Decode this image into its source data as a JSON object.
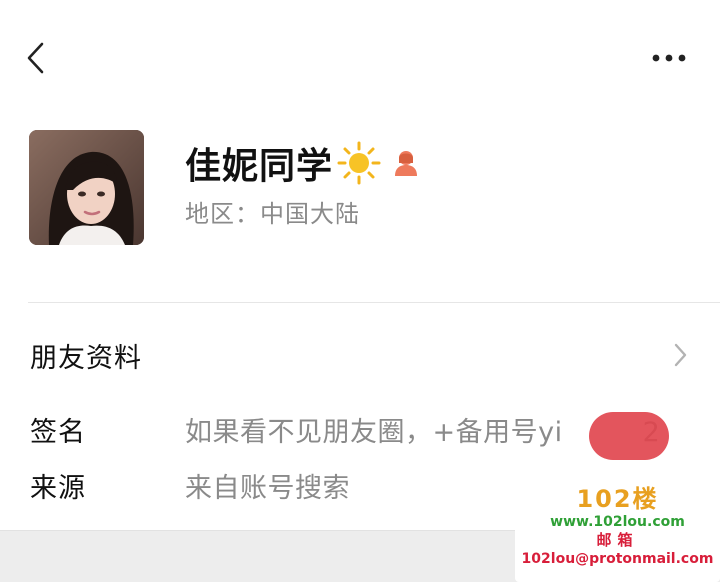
{
  "topbar": {
    "back_icon": "chevron-left-icon",
    "more_icon": "more-horizontal-icon"
  },
  "profile": {
    "avatar": "avatar",
    "name": "佳妮同学",
    "name_emoji_icon": "sun-icon",
    "gender_icon": "female-person-icon",
    "region": "地区：中国大陆"
  },
  "friend_info": {
    "label": "朋友资料",
    "chevron_icon": "chevron-right-icon"
  },
  "details": {
    "signature_label": "签名",
    "signature_value": "如果看不见朋友圈，+备用号yi",
    "signature_tail": "2",
    "source_label": "来源",
    "source_value": "来自账号搜索"
  },
  "watermark": {
    "logo": "102楼",
    "url": "www.102lou.com",
    "mail_title": "邮箱",
    "mail": "102lou@protonmail.com"
  },
  "colors": {
    "accent_orange": "#e8a020",
    "watermark_green": "#2fa036",
    "watermark_red": "#d81e3a",
    "redaction": "#e0434b",
    "secondary_text": "#8a8a8a"
  }
}
